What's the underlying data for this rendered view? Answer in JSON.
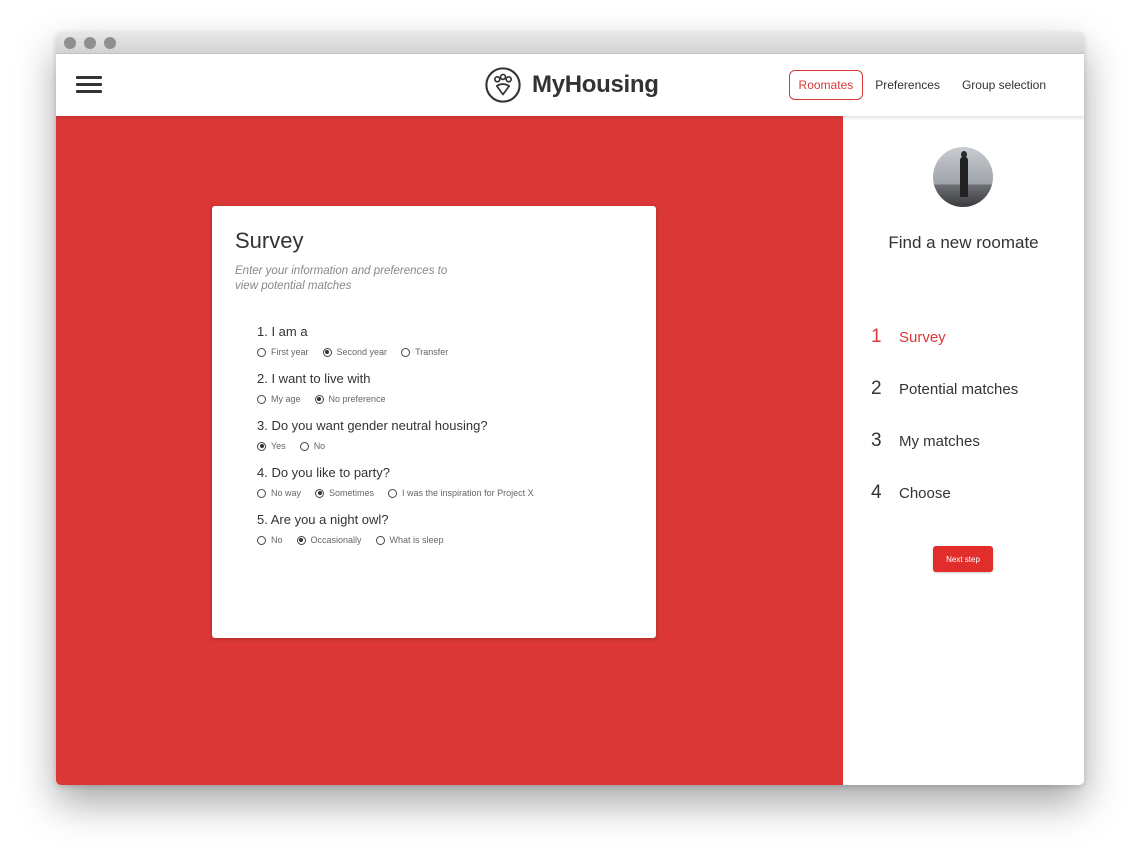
{
  "app": {
    "brand_name": "MyHousing"
  },
  "nav": {
    "links": [
      {
        "label": "Roomates",
        "active": true
      },
      {
        "label": "Preferences",
        "active": false
      },
      {
        "label": "Group selection",
        "active": false
      }
    ]
  },
  "survey": {
    "title": "Survey",
    "subtitle": "Enter your information and preferences to view potential matches",
    "questions": [
      {
        "label": "1. I am a",
        "options": [
          "First year",
          "Second year",
          "Transfer"
        ],
        "selected": "Second year"
      },
      {
        "label": "2. I want to live with",
        "options": [
          "My age",
          "No preference"
        ],
        "selected": "No preference"
      },
      {
        "label": "3. Do you want gender neutral housing?",
        "options": [
          "Yes",
          "No"
        ],
        "selected": "Yes"
      },
      {
        "label": "4. Do you like to party?",
        "options": [
          "No way",
          "Sometimes",
          "I was the inspiration for Project X"
        ],
        "selected": "Sometimes"
      },
      {
        "label": "5. Are you a night owl?",
        "options": [
          "No",
          "Occasionally",
          "What is sleep"
        ],
        "selected": "Occasionally"
      }
    ]
  },
  "sidebar": {
    "title": "Find a new roomate",
    "steps": [
      {
        "number": "1",
        "label": "Survey",
        "active": true
      },
      {
        "number": "2",
        "label": "Potential matches",
        "active": false
      },
      {
        "number": "3",
        "label": "My matches",
        "active": false
      },
      {
        "number": "4",
        "label": "Choose",
        "active": false
      }
    ],
    "next_label": "Next step"
  },
  "colors": {
    "accent": "#dc3737",
    "button": "#e22d2d",
    "text": "#333333"
  }
}
